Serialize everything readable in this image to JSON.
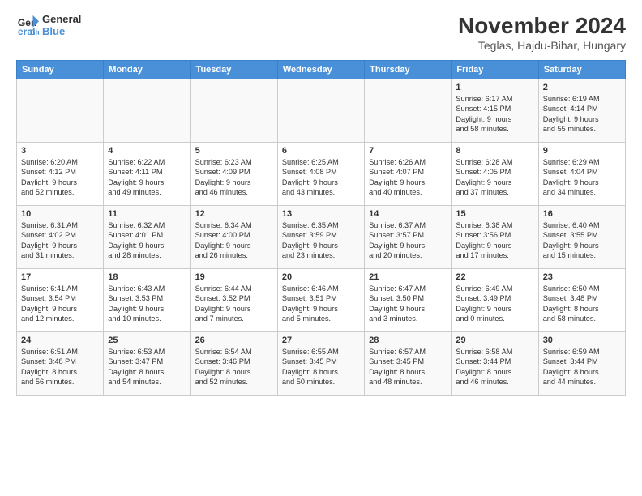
{
  "logo": {
    "line1": "General",
    "line2": "Blue"
  },
  "title": "November 2024",
  "subtitle": "Teglas, Hajdu-Bihar, Hungary",
  "days_header": [
    "Sunday",
    "Monday",
    "Tuesday",
    "Wednesday",
    "Thursday",
    "Friday",
    "Saturday"
  ],
  "weeks": [
    [
      {
        "day": "",
        "info": ""
      },
      {
        "day": "",
        "info": ""
      },
      {
        "day": "",
        "info": ""
      },
      {
        "day": "",
        "info": ""
      },
      {
        "day": "",
        "info": ""
      },
      {
        "day": "1",
        "info": "Sunrise: 6:17 AM\nSunset: 4:15 PM\nDaylight: 9 hours\nand 58 minutes."
      },
      {
        "day": "2",
        "info": "Sunrise: 6:19 AM\nSunset: 4:14 PM\nDaylight: 9 hours\nand 55 minutes."
      }
    ],
    [
      {
        "day": "3",
        "info": "Sunrise: 6:20 AM\nSunset: 4:12 PM\nDaylight: 9 hours\nand 52 minutes."
      },
      {
        "day": "4",
        "info": "Sunrise: 6:22 AM\nSunset: 4:11 PM\nDaylight: 9 hours\nand 49 minutes."
      },
      {
        "day": "5",
        "info": "Sunrise: 6:23 AM\nSunset: 4:09 PM\nDaylight: 9 hours\nand 46 minutes."
      },
      {
        "day": "6",
        "info": "Sunrise: 6:25 AM\nSunset: 4:08 PM\nDaylight: 9 hours\nand 43 minutes."
      },
      {
        "day": "7",
        "info": "Sunrise: 6:26 AM\nSunset: 4:07 PM\nDaylight: 9 hours\nand 40 minutes."
      },
      {
        "day": "8",
        "info": "Sunrise: 6:28 AM\nSunset: 4:05 PM\nDaylight: 9 hours\nand 37 minutes."
      },
      {
        "day": "9",
        "info": "Sunrise: 6:29 AM\nSunset: 4:04 PM\nDaylight: 9 hours\nand 34 minutes."
      }
    ],
    [
      {
        "day": "10",
        "info": "Sunrise: 6:31 AM\nSunset: 4:02 PM\nDaylight: 9 hours\nand 31 minutes."
      },
      {
        "day": "11",
        "info": "Sunrise: 6:32 AM\nSunset: 4:01 PM\nDaylight: 9 hours\nand 28 minutes."
      },
      {
        "day": "12",
        "info": "Sunrise: 6:34 AM\nSunset: 4:00 PM\nDaylight: 9 hours\nand 26 minutes."
      },
      {
        "day": "13",
        "info": "Sunrise: 6:35 AM\nSunset: 3:59 PM\nDaylight: 9 hours\nand 23 minutes."
      },
      {
        "day": "14",
        "info": "Sunrise: 6:37 AM\nSunset: 3:57 PM\nDaylight: 9 hours\nand 20 minutes."
      },
      {
        "day": "15",
        "info": "Sunrise: 6:38 AM\nSunset: 3:56 PM\nDaylight: 9 hours\nand 17 minutes."
      },
      {
        "day": "16",
        "info": "Sunrise: 6:40 AM\nSunset: 3:55 PM\nDaylight: 9 hours\nand 15 minutes."
      }
    ],
    [
      {
        "day": "17",
        "info": "Sunrise: 6:41 AM\nSunset: 3:54 PM\nDaylight: 9 hours\nand 12 minutes."
      },
      {
        "day": "18",
        "info": "Sunrise: 6:43 AM\nSunset: 3:53 PM\nDaylight: 9 hours\nand 10 minutes."
      },
      {
        "day": "19",
        "info": "Sunrise: 6:44 AM\nSunset: 3:52 PM\nDaylight: 9 hours\nand 7 minutes."
      },
      {
        "day": "20",
        "info": "Sunrise: 6:46 AM\nSunset: 3:51 PM\nDaylight: 9 hours\nand 5 minutes."
      },
      {
        "day": "21",
        "info": "Sunrise: 6:47 AM\nSunset: 3:50 PM\nDaylight: 9 hours\nand 3 minutes."
      },
      {
        "day": "22",
        "info": "Sunrise: 6:49 AM\nSunset: 3:49 PM\nDaylight: 9 hours\nand 0 minutes."
      },
      {
        "day": "23",
        "info": "Sunrise: 6:50 AM\nSunset: 3:48 PM\nDaylight: 8 hours\nand 58 minutes."
      }
    ],
    [
      {
        "day": "24",
        "info": "Sunrise: 6:51 AM\nSunset: 3:48 PM\nDaylight: 8 hours\nand 56 minutes."
      },
      {
        "day": "25",
        "info": "Sunrise: 6:53 AM\nSunset: 3:47 PM\nDaylight: 8 hours\nand 54 minutes."
      },
      {
        "day": "26",
        "info": "Sunrise: 6:54 AM\nSunset: 3:46 PM\nDaylight: 8 hours\nand 52 minutes."
      },
      {
        "day": "27",
        "info": "Sunrise: 6:55 AM\nSunset: 3:45 PM\nDaylight: 8 hours\nand 50 minutes."
      },
      {
        "day": "28",
        "info": "Sunrise: 6:57 AM\nSunset: 3:45 PM\nDaylight: 8 hours\nand 48 minutes."
      },
      {
        "day": "29",
        "info": "Sunrise: 6:58 AM\nSunset: 3:44 PM\nDaylight: 8 hours\nand 46 minutes."
      },
      {
        "day": "30",
        "info": "Sunrise: 6:59 AM\nSunset: 3:44 PM\nDaylight: 8 hours\nand 44 minutes."
      }
    ]
  ]
}
